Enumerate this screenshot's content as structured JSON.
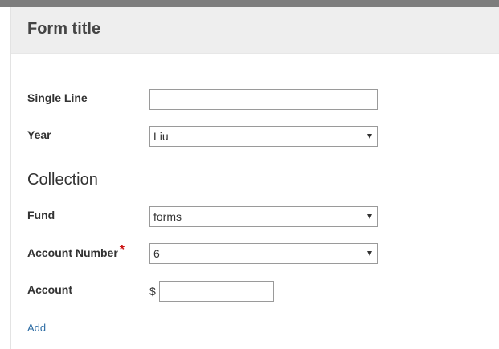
{
  "form": {
    "title": "Form title"
  },
  "fields": {
    "single_line": {
      "label": "Single Line",
      "value": ""
    },
    "year": {
      "label": "Year",
      "selected": "Liu"
    }
  },
  "collection": {
    "title": "Collection",
    "fund": {
      "label": "Fund",
      "selected": "forms"
    },
    "account_number": {
      "label": "Account Number",
      "required_marker": "*",
      "selected": "6"
    },
    "account": {
      "label": "Account",
      "currency_symbol": "$",
      "value": ""
    },
    "add_label": "Add"
  },
  "icons": {
    "dropdown": "caret-down-icon"
  },
  "colors": {
    "top_bar": "#7d7d7d",
    "header_bg": "#eeeeee",
    "link": "#2e6da4",
    "required": "#cc1111"
  }
}
